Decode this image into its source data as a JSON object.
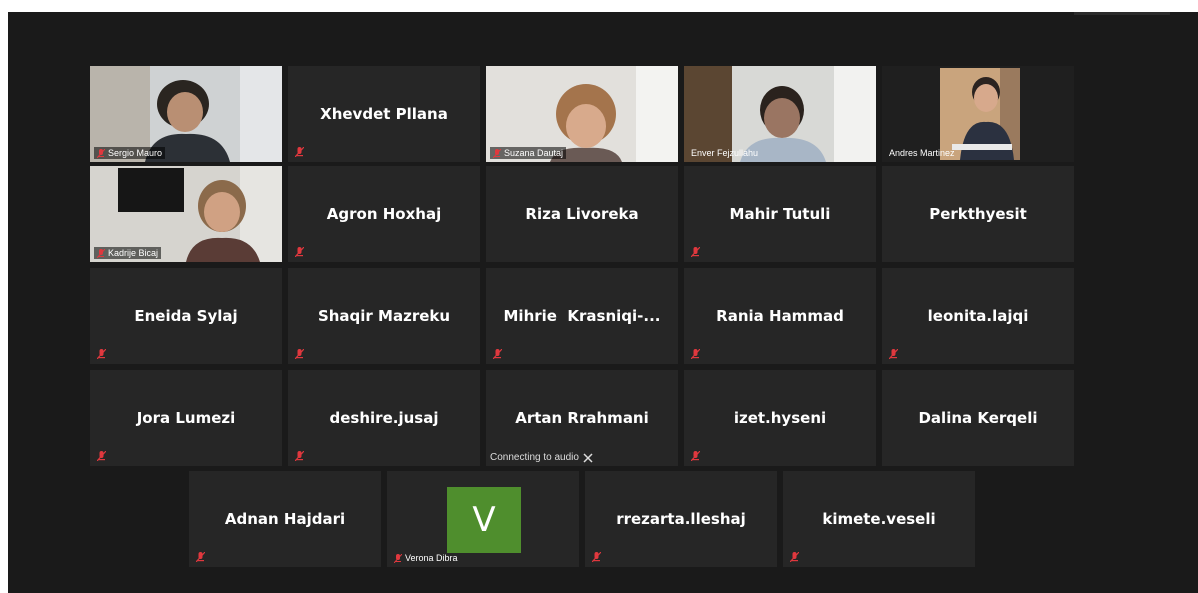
{
  "meeting": {
    "participants": [
      {
        "name": "Sergio Mauro",
        "type": "video"
      },
      {
        "name": "Xhevdet Pllana",
        "type": "name"
      },
      {
        "name": "Suzana Dautaj",
        "type": "video"
      },
      {
        "name": "Enver Fejzullahu",
        "type": "video"
      },
      {
        "name": "Andres Martinez",
        "type": "video",
        "active": true
      },
      {
        "name": "Kadrije Bicaj",
        "type": "video"
      },
      {
        "name": "Agron Hoxhaj",
        "type": "name"
      },
      {
        "name": "Riza Livoreka",
        "type": "name"
      },
      {
        "name": "Mahir Tutuli",
        "type": "name"
      },
      {
        "name": "Perkthyesit",
        "type": "name"
      },
      {
        "name": "Eneida Sylaj",
        "type": "name"
      },
      {
        "name": "Shaqir Mazreku",
        "type": "name"
      },
      {
        "name": "Mihrie  Krasniqi-...",
        "type": "name"
      },
      {
        "name": "Rania Hammad",
        "type": "name"
      },
      {
        "name": "leonita.lajqi",
        "type": "name"
      },
      {
        "name": "Jora Lumezi",
        "type": "name"
      },
      {
        "name": "deshire.jusaj",
        "type": "name"
      },
      {
        "name": "Artan Rrahmani",
        "type": "name",
        "status": "Connecting to audio"
      },
      {
        "name": "izet.hyseni",
        "type": "name"
      },
      {
        "name": "Dalina Kerqeli",
        "type": "name"
      },
      {
        "name": "Adnan Hajdari",
        "type": "name"
      },
      {
        "name": "Verona Dibra",
        "type": "avatar",
        "initial": "V"
      },
      {
        "name": "rrezarta.lleshaj",
        "type": "name"
      },
      {
        "name": "kimete.veseli",
        "type": "name"
      }
    ]
  },
  "colors": {
    "background": "#1a1a1a",
    "tile": "#262626",
    "active_border": "#c7e155",
    "mute_icon": "#e0383e",
    "avatar_bg": "#4f8e2d"
  }
}
